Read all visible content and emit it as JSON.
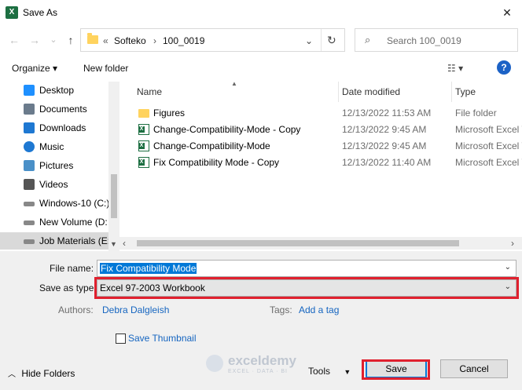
{
  "window": {
    "title": "Save As",
    "app_icon_letter": "X",
    "close_glyph": "✕"
  },
  "nav": {
    "back": "←",
    "forward": "→",
    "recent": "⌄",
    "up": "↑",
    "breadcrumb": {
      "chevron": "«",
      "segments": [
        "Softeko",
        "100_0019"
      ],
      "separator": "›",
      "dropdown": "⌄",
      "refresh": "↻"
    },
    "search_placeholder": "Search 100_0019"
  },
  "toolbar": {
    "organize": "Organize ▾",
    "new_folder": "New folder",
    "view": "☷ ▾",
    "help": "?"
  },
  "sidebar": {
    "items": [
      {
        "label": "Desktop",
        "icon": "desktop-icon",
        "color": "#1e90ff"
      },
      {
        "label": "Documents",
        "icon": "documents-icon",
        "color": "#6b7b8c"
      },
      {
        "label": "Downloads",
        "icon": "downloads-icon",
        "color": "#1e78d2"
      },
      {
        "label": "Music",
        "icon": "music-icon",
        "color": "#1e78d2"
      },
      {
        "label": "Pictures",
        "icon": "pictures-icon",
        "color": "#4a90c8"
      },
      {
        "label": "Videos",
        "icon": "videos-icon",
        "color": "#555555"
      },
      {
        "label": "Windows-10 (C:)",
        "icon": "drive-icon",
        "color": "#888888"
      },
      {
        "label": "New Volume (D:",
        "icon": "drive-icon",
        "color": "#888888"
      },
      {
        "label": "Job Materials (E:",
        "icon": "drive-icon",
        "color": "#888888"
      }
    ],
    "selected_index": 8
  },
  "files": {
    "columns": {
      "name": "Name",
      "date": "Date modified",
      "type": "Type"
    },
    "rows": [
      {
        "name": "Figures",
        "date": "12/13/2022 11:53 AM",
        "type": "File folder",
        "kind": "folder"
      },
      {
        "name": "Change-Compatibility-Mode - Copy",
        "date": "12/13/2022 9:45 AM",
        "type": "Microsoft Excel W",
        "kind": "excel"
      },
      {
        "name": "Change-Compatibility-Mode",
        "date": "12/13/2022 9:45 AM",
        "type": "Microsoft Excel W",
        "kind": "excel"
      },
      {
        "name": "Fix Compatibility Mode - Copy",
        "date": "12/13/2022 11:40 AM",
        "type": "Microsoft Excel W",
        "kind": "excel"
      }
    ]
  },
  "form": {
    "file_name_label": "File name:",
    "file_name": "Fix Compatibility Mode",
    "save_type_label": "Save as type:",
    "save_type": "Excel 97-2003 Workbook",
    "authors_label": "Authors:",
    "authors": "Debra Dalgleish",
    "tags_label": "Tags:",
    "tags": "Add a tag",
    "thumbnail_label": "Save Thumbnail"
  },
  "footer": {
    "hide_folders": "Hide Folders",
    "tools": "Tools",
    "save": "Save",
    "cancel": "Cancel"
  },
  "watermark": {
    "name": "exceldemy",
    "tagline": "EXCEL · DATA · BI"
  },
  "colors": {
    "accent": "#0078d7",
    "highlight": "#e0202e",
    "excel": "#1d6f42",
    "folder": "#ffd35e"
  }
}
